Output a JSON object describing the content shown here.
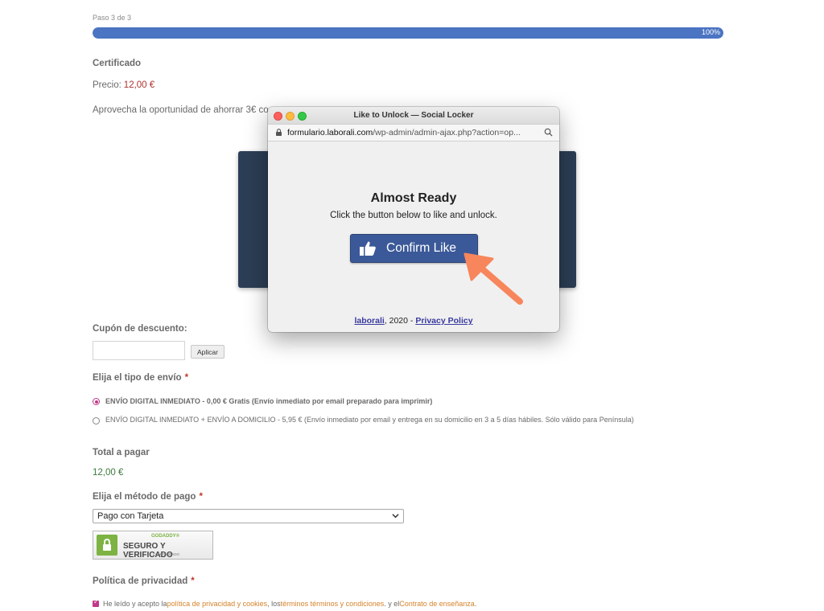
{
  "progress": {
    "step_label": "Paso 3 de 3",
    "percent": 100,
    "percent_label": "100%"
  },
  "product": {
    "title": "Certificado",
    "price_label": "Precio:",
    "price_value": "12,00 €",
    "promo_text": "Aprovecha la oportunidad de ahorrar 3€ co"
  },
  "coupon": {
    "label": "Cupón de descuento:",
    "input_value": "",
    "apply_label": "Aplicar"
  },
  "shipping": {
    "label": "Elija el tipo de envío",
    "required_mark": "*",
    "options": [
      {
        "selected": true,
        "bold_text": "ENVÍO DIGITAL INMEDIATO - 0,00 € Gratis (Envío inmediato por email preparado para imprimir)",
        "text": ""
      },
      {
        "selected": false,
        "bold_text": "",
        "text": "ENVÍO DIGITAL INMEDIATO + ENVÍO A DOMICILIO - 5,95 € (Envío inmediato por email y entrega en su domicilio en 3 a 5 días hábiles. Sólo válido para Península)"
      }
    ]
  },
  "total": {
    "label": "Total a pagar",
    "value": "12,00 €"
  },
  "payment": {
    "label": "Elija el método de pago",
    "required_mark": "*",
    "selected": "Pago con Tarjeta",
    "badge": {
      "top": "GODADDY®",
      "main": "SEGURO Y VERIFICADO",
      "sub": "COMPROBADO"
    }
  },
  "privacy": {
    "label": "Política de privacidad",
    "required_mark": "*",
    "checked": true,
    "text_1": "He leído y acepto la ",
    "link_1": "política de privacidad y cookies",
    "text_2": ", los ",
    "link_2": "términos términos y condiciones",
    "text_3": ". y el ",
    "link_3": "Contrato de enseñanza",
    "text_4": "."
  },
  "popup": {
    "window_title": "Like to Unlock — Social Locker",
    "url_domain": "formulario.laborali.com",
    "url_path": "/wp-admin/admin-ajax.php?action=op...",
    "heading": "Almost Ready",
    "subheading": "Click the button below to like and unlock.",
    "button_label": "Confirm Like",
    "footer_brand": "laborali",
    "footer_year": ", 2020 - ",
    "footer_policy": "Privacy Policy"
  },
  "colors": {
    "facebook_blue": "#3b5998",
    "progress_blue": "#4b74c2",
    "arrow_orange": "#f7865c",
    "accent_magenta": "#c0398a",
    "price_red": "#b03030",
    "total_green": "#3a7a3a"
  }
}
